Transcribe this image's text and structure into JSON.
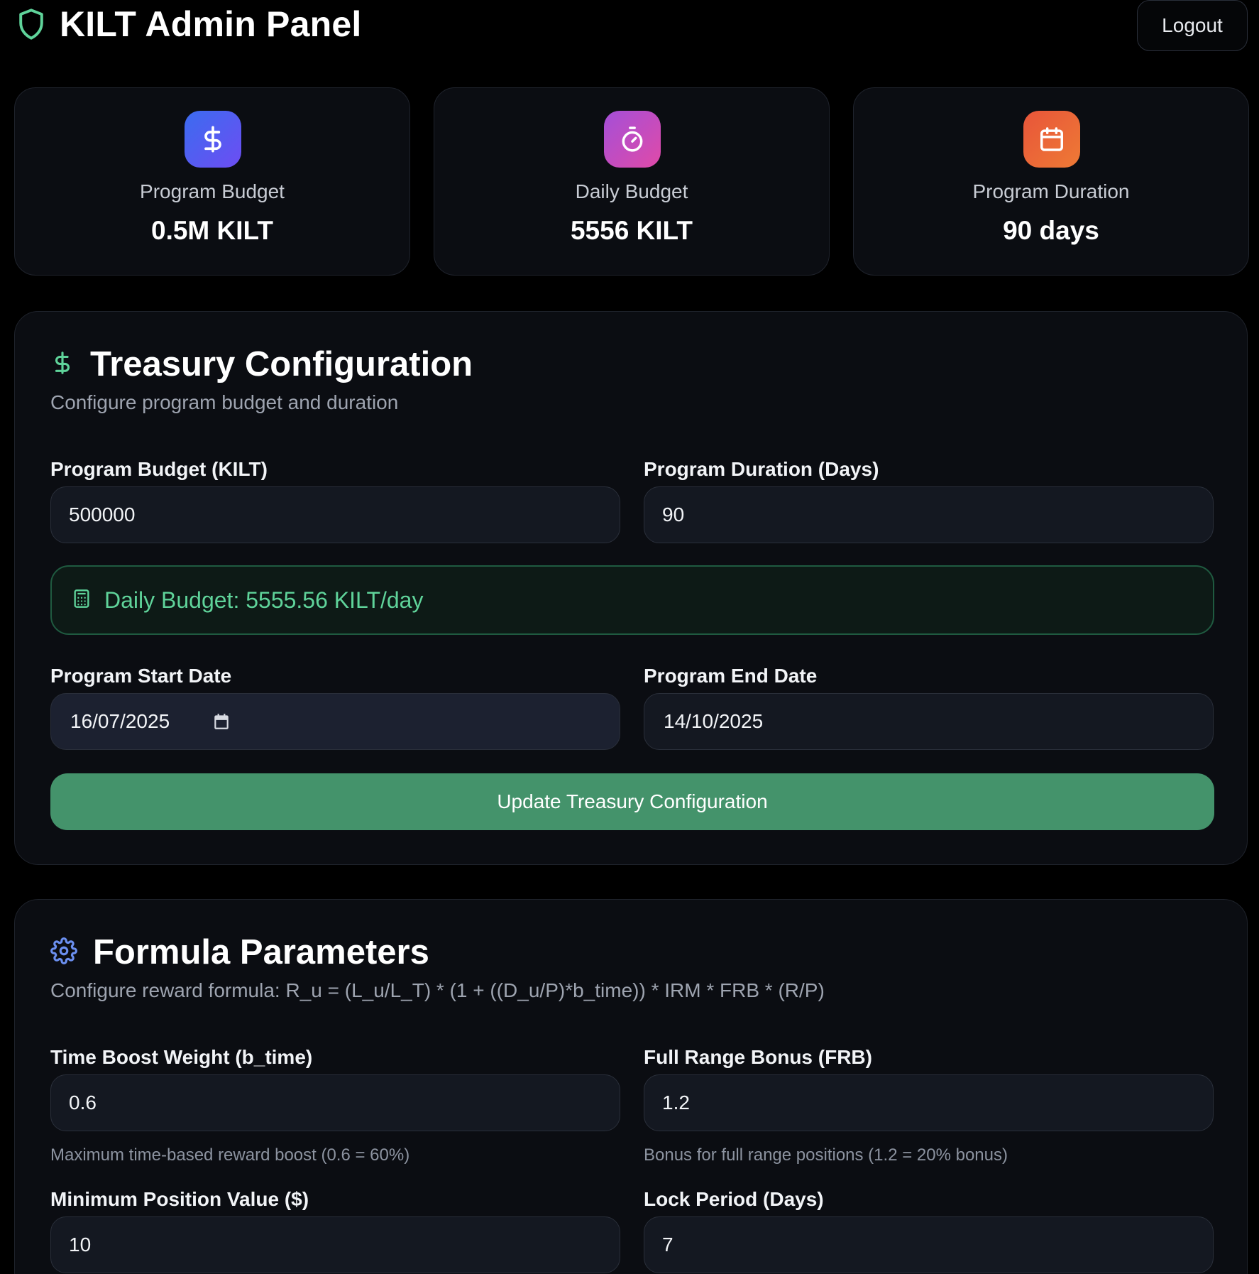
{
  "header": {
    "title": "KILT Admin Panel",
    "logout_label": "Logout"
  },
  "stats": [
    {
      "icon": "dollar-icon",
      "label": "Program Budget",
      "value": "0.5M KILT",
      "color_from": "#3b6cf0",
      "color_to": "#6d4df2"
    },
    {
      "icon": "timer-icon",
      "label": "Daily Budget",
      "value": "5556 KILT",
      "color_from": "#a44fd8",
      "color_to": "#e04aa8"
    },
    {
      "icon": "calendar-icon",
      "label": "Program Duration",
      "value": "90 days",
      "color_from": "#e8553a",
      "color_to": "#ee7a35"
    }
  ],
  "treasury": {
    "title": "Treasury Configuration",
    "subtitle": "Configure program budget and duration",
    "budget_label": "Program Budget (KILT)",
    "budget_value": "500000",
    "duration_label": "Program Duration (Days)",
    "duration_value": "90",
    "daily_budget_text": "Daily Budget: 5555.56 KILT/day",
    "start_label": "Program Start Date",
    "start_value": "16/07/2025",
    "end_label": "Program End Date",
    "end_value": "14/10/2025",
    "update_label": "Update Treasury Configuration"
  },
  "formula": {
    "title": "Formula Parameters",
    "subtitle": "Configure reward formula: R_u = (L_u/L_T) * (1 + ((D_u/P)*b_time)) * IRM * FRB * (R/P)",
    "time_boost_label": "Time Boost Weight (b_time)",
    "time_boost_value": "0.6",
    "time_boost_help": "Maximum time-based reward boost (0.6 = 60%)",
    "frb_label": "Full Range Bonus (FRB)",
    "frb_value": "1.2",
    "frb_help": "Bonus for full range positions (1.2 = 20% bonus)",
    "min_position_label": "Minimum Position Value ($)",
    "min_position_value": "10",
    "lock_period_label": "Lock Period (Days)",
    "lock_period_value": "7"
  },
  "colors": {
    "accent_green": "#44936b",
    "brand_green": "#5fd39a",
    "gear_blue": "#6b8ff0"
  }
}
